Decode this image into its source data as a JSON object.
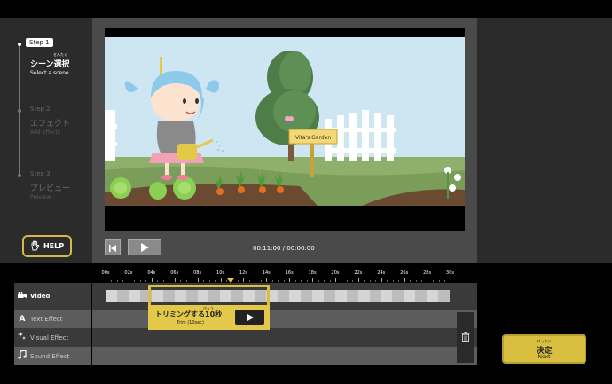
{
  "steps": [
    {
      "label": "Step 1",
      "title": "シーン選択",
      "ruby": "せんたく",
      "sub": "Select a scene"
    },
    {
      "label": "Step 2",
      "title": "エフェクト",
      "ruby": "",
      "sub": "Add effects"
    },
    {
      "label": "Step 3",
      "title": "プレビュー",
      "ruby": "",
      "sub": "Preview"
    }
  ],
  "help": {
    "label": "HELP",
    "icon": "hand-icon"
  },
  "preview": {
    "sign_text": "Vita's Garden",
    "time_readout": "00:11:00 / 00:00:00"
  },
  "ruler": {
    "labels": [
      "00s",
      "02s",
      "04s",
      "06s",
      "08s",
      "10s",
      "12s",
      "14s",
      "16s",
      "18s",
      "20s",
      "22s",
      "24s",
      "26s",
      "28s",
      "30s"
    ]
  },
  "tracks": [
    {
      "label": "Video",
      "icon": "film-icon"
    },
    {
      "label": "Text Effect",
      "icon": "text-icon"
    },
    {
      "label": "Visual Effect",
      "icon": "sparkle-icon"
    },
    {
      "label": "Sound Effect",
      "icon": "music-note-icon"
    }
  ],
  "trim": {
    "title": "トリミングする10秒",
    "ruby": "びょう",
    "sub": "Trim (10sec)"
  },
  "decide": {
    "ruby": "けってい",
    "label": "決定",
    "sub": "Next"
  },
  "colors": {
    "accent": "#d9bf3f",
    "panel": "#2b2b2b",
    "preview_bg": "#4a4a4a"
  }
}
